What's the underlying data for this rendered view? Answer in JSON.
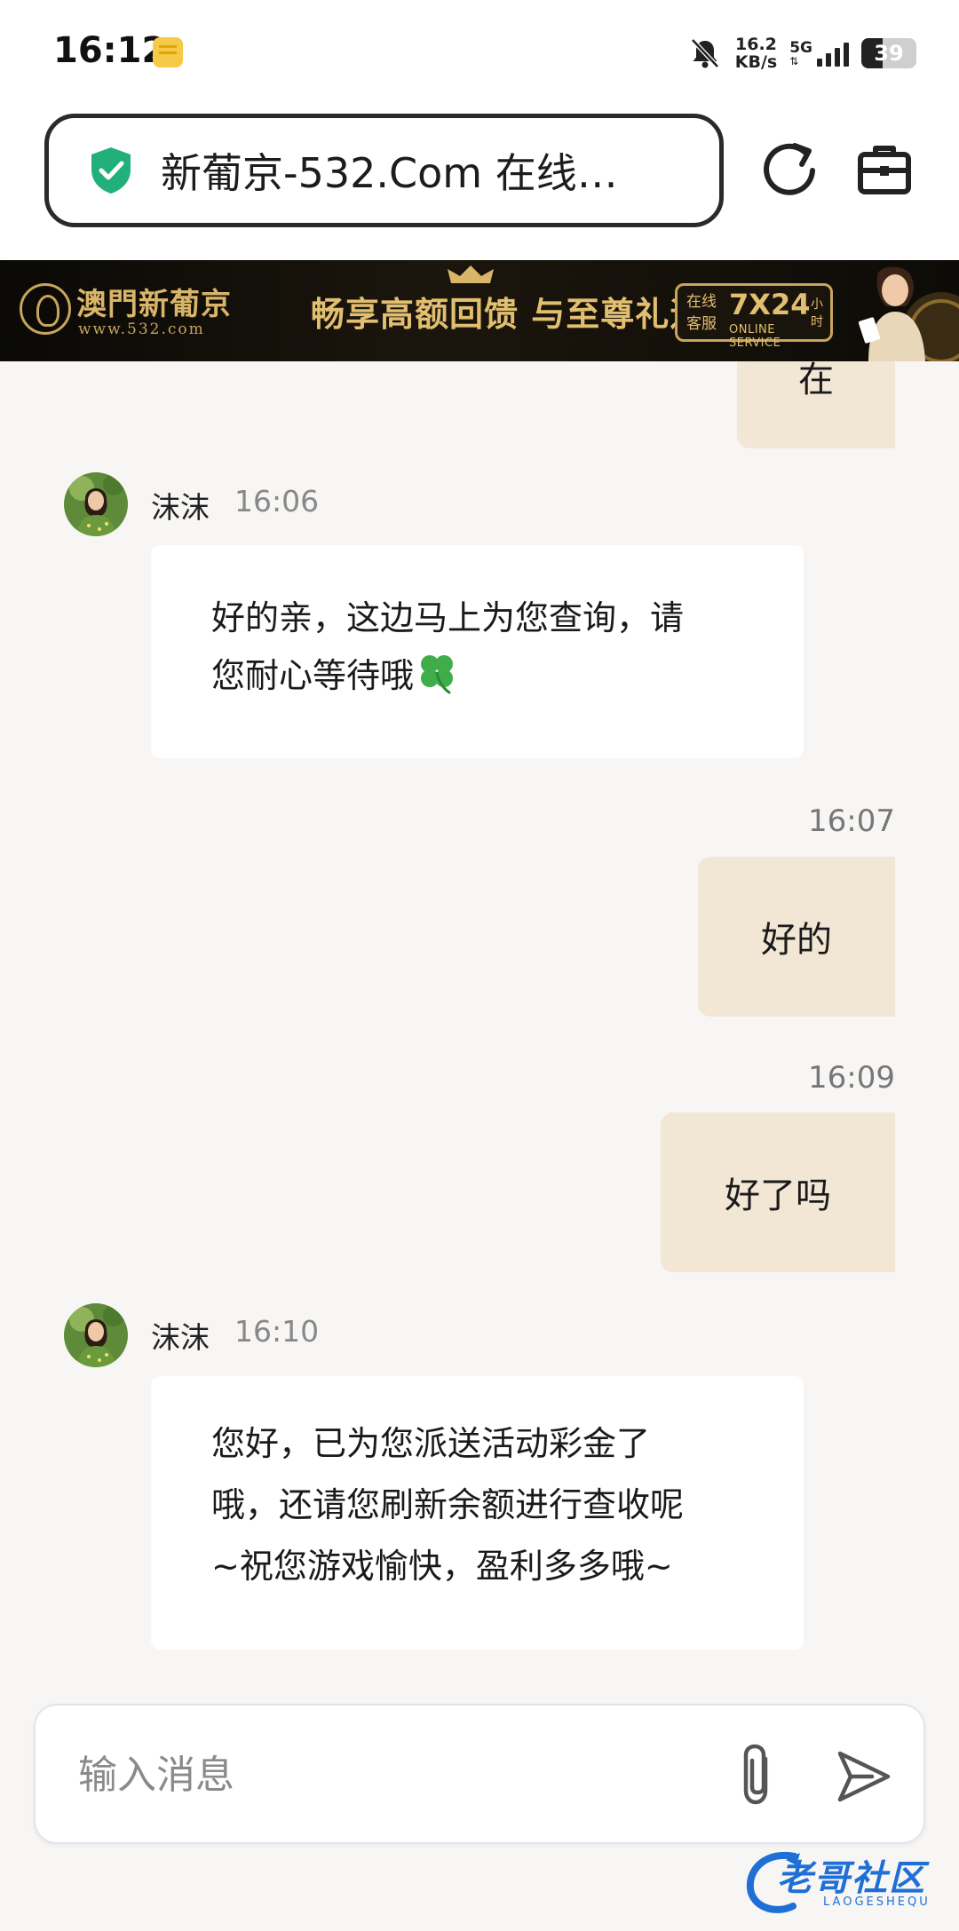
{
  "status_bar": {
    "time": "16:12",
    "speed_value": "16.2",
    "speed_unit": "KB/s",
    "network": "5G",
    "battery": "39",
    "battery_level": 0.39
  },
  "browser": {
    "url_title": "新葡京-532.Com 在线…"
  },
  "banner": {
    "brand_name": "澳門新葡京",
    "brand_url": "www.532.com",
    "slogan": "畅享高额回馈 与至尊礼遇",
    "service_left_1": "在线",
    "service_left_2": "客服",
    "service_big": "7X24",
    "service_hours": "小时",
    "service_small": "ONLINE SERVICE"
  },
  "chat": {
    "partial_bubble_text": "在",
    "messages": [
      {
        "sender": "沫沫",
        "time": "16:06",
        "text_lines": [
          "好的亲，这边马上为您查询，请",
          "您耐心等待哦"
        ]
      },
      {
        "time": "16:07",
        "text": "好的"
      },
      {
        "time": "16:09",
        "text": "好了吗"
      },
      {
        "sender": "沫沫",
        "time": "16:10",
        "text_lines": [
          "您好，已为您派送活动彩金了",
          "哦，还请您刷新余额进行查收呢",
          "~祝您游戏愉快，盈利多多哦~"
        ]
      }
    ]
  },
  "input": {
    "placeholder": "输入消息"
  },
  "watermark": {
    "text": "老哥社区",
    "sub": "LAOGESHEQU"
  },
  "colors": {
    "accent_green": "#22b07a",
    "outgoing_bubble": "#f2e6d5",
    "banner_gold": "#d9b56a"
  }
}
